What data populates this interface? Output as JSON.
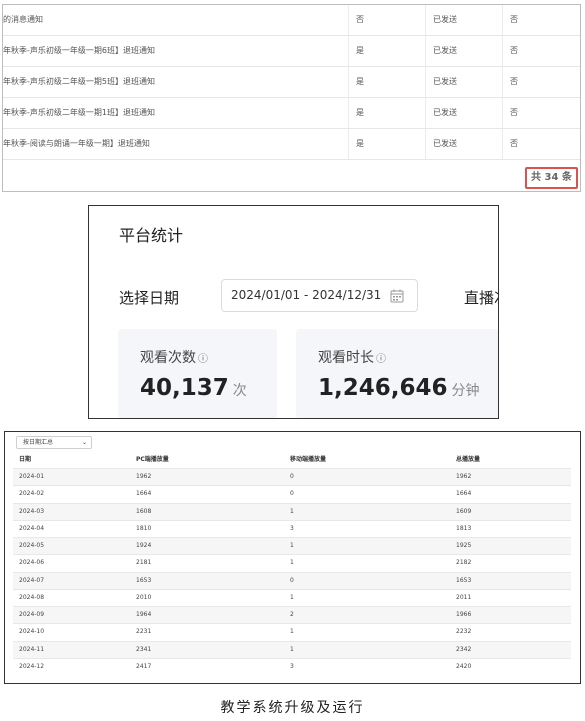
{
  "notifications": {
    "rows": [
      {
        "title": "的消息通知",
        "flag": "否",
        "status": "已发送",
        "read": "否"
      },
      {
        "title": "年秋季-声乐初级一年级一期6班】退班通知",
        "flag": "是",
        "status": "已发送",
        "read": "否"
      },
      {
        "title": "年秋季-声乐初级二年级一期5班】退班通知",
        "flag": "是",
        "status": "已发送",
        "read": "否"
      },
      {
        "title": "年秋季-声乐初级二年级一期1班】退班通知",
        "flag": "是",
        "status": "已发送",
        "read": "否"
      },
      {
        "title": "年秋季-阅读与朗诵一年级一期】退班通知",
        "flag": "是",
        "status": "已发送",
        "read": "否"
      }
    ],
    "total": "共 34 条"
  },
  "platform_stats": {
    "title": "平台统计",
    "date_label": "选择日期",
    "date_range": "2024/01/01 - 2024/12/31",
    "live_label": "直播次",
    "cards": [
      {
        "label": "观看次数",
        "value": "40,137",
        "unit": "次"
      },
      {
        "label": "观看时长",
        "value": "1,246,646",
        "unit": "分钟"
      }
    ]
  },
  "monthly_table": {
    "select_value": "按日期汇总",
    "headers": [
      "日期",
      "PC端播放量",
      "移动端播放量",
      "总播放量"
    ],
    "rows": [
      [
        "2024-01",
        "1962",
        "0",
        "1962"
      ],
      [
        "2024-02",
        "1664",
        "0",
        "1664"
      ],
      [
        "2024-03",
        "1608",
        "1",
        "1609"
      ],
      [
        "2024-04",
        "1810",
        "3",
        "1813"
      ],
      [
        "2024-05",
        "1924",
        "1",
        "1925"
      ],
      [
        "2024-06",
        "2181",
        "1",
        "2182"
      ],
      [
        "2024-07",
        "1653",
        "0",
        "1653"
      ],
      [
        "2024-08",
        "2010",
        "1",
        "2011"
      ],
      [
        "2024-09",
        "1964",
        "2",
        "1966"
      ],
      [
        "2024-10",
        "2231",
        "1",
        "2232"
      ],
      [
        "2024-11",
        "2341",
        "1",
        "2342"
      ],
      [
        "2024-12",
        "2417",
        "3",
        "2420"
      ]
    ]
  },
  "caption": "教学系统升级及运行"
}
